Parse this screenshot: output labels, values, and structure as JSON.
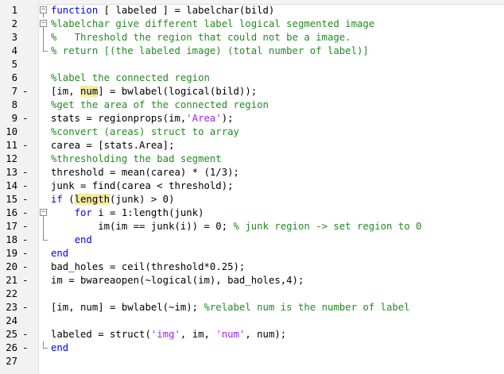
{
  "editor": {
    "lines": [
      {
        "n": "1",
        "dash": false,
        "fold": "box",
        "segments": [
          {
            "t": "function",
            "c": "kw"
          },
          {
            "t": " [ labeled ] = labelchar(bild)",
            "c": ""
          }
        ]
      },
      {
        "n": "2",
        "dash": false,
        "fold": "box",
        "segments": [
          {
            "t": "%labelchar give different label logical segmented image",
            "c": "cm"
          }
        ]
      },
      {
        "n": "3",
        "dash": false,
        "fold": "line",
        "segments": [
          {
            "t": "%   Threshold the region that could not be a image.",
            "c": "cm"
          }
        ]
      },
      {
        "n": "4",
        "dash": false,
        "fold": "end",
        "segments": [
          {
            "t": "% return [(the labeled image) (total number of label)]",
            "c": "cm"
          }
        ]
      },
      {
        "n": "5",
        "dash": false,
        "fold": "",
        "segments": []
      },
      {
        "n": "6",
        "dash": false,
        "fold": "",
        "segments": [
          {
            "t": "%label the connected region",
            "c": "cm"
          }
        ]
      },
      {
        "n": "7",
        "dash": true,
        "fold": "",
        "segments": [
          {
            "t": "[im, ",
            "c": ""
          },
          {
            "t": "num",
            "c": "hl"
          },
          {
            "t": "] = bwlabel(logical(bild));",
            "c": ""
          }
        ]
      },
      {
        "n": "8",
        "dash": false,
        "fold": "",
        "segments": [
          {
            "t": "%get the area of the connected region",
            "c": "cm"
          }
        ]
      },
      {
        "n": "9",
        "dash": true,
        "fold": "",
        "segments": [
          {
            "t": "stats = regionprops(im,",
            "c": ""
          },
          {
            "t": "'Area'",
            "c": "st"
          },
          {
            "t": ");",
            "c": ""
          }
        ]
      },
      {
        "n": "10",
        "dash": false,
        "fold": "",
        "segments": [
          {
            "t": "%convert (areas) struct to array",
            "c": "cm"
          }
        ]
      },
      {
        "n": "11",
        "dash": true,
        "fold": "",
        "segments": [
          {
            "t": "carea = [stats.Area];",
            "c": ""
          }
        ]
      },
      {
        "n": "12",
        "dash": false,
        "fold": "",
        "segments": [
          {
            "t": "%thresholding the bad segment",
            "c": "cm"
          }
        ]
      },
      {
        "n": "13",
        "dash": true,
        "fold": "",
        "segments": [
          {
            "t": "threshold = mean(carea) * (1/3);",
            "c": ""
          }
        ]
      },
      {
        "n": "14",
        "dash": true,
        "fold": "",
        "segments": [
          {
            "t": "junk = find(carea < threshold);",
            "c": ""
          }
        ]
      },
      {
        "n": "15",
        "dash": true,
        "fold": "",
        "segments": [
          {
            "t": "if",
            "c": "kw"
          },
          {
            "t": " (",
            "c": ""
          },
          {
            "t": "length",
            "c": "hl"
          },
          {
            "t": "(junk) > 0)",
            "c": ""
          }
        ]
      },
      {
        "n": "16",
        "dash": true,
        "fold": "box",
        "segments": [
          {
            "t": "    ",
            "c": ""
          },
          {
            "t": "for",
            "c": "kw"
          },
          {
            "t": " i = 1:length(junk)",
            "c": ""
          }
        ]
      },
      {
        "n": "17",
        "dash": true,
        "fold": "line",
        "segments": [
          {
            "t": "        im(im == junk(i)) = 0; ",
            "c": ""
          },
          {
            "t": "% junk region -> set region to 0",
            "c": "cm"
          }
        ]
      },
      {
        "n": "18",
        "dash": true,
        "fold": "end",
        "segments": [
          {
            "t": "    ",
            "c": ""
          },
          {
            "t": "end",
            "c": "kw"
          }
        ]
      },
      {
        "n": "19",
        "dash": true,
        "fold": "",
        "segments": [
          {
            "t": "end",
            "c": "kw"
          }
        ]
      },
      {
        "n": "20",
        "dash": true,
        "fold": "",
        "segments": [
          {
            "t": "bad_holes = ceil(threshold*0.25);",
            "c": ""
          }
        ]
      },
      {
        "n": "21",
        "dash": true,
        "fold": "",
        "segments": [
          {
            "t": "im = bwareaopen(~logical(im), bad_holes,4);",
            "c": ""
          }
        ]
      },
      {
        "n": "22",
        "dash": false,
        "fold": "",
        "segments": []
      },
      {
        "n": "23",
        "dash": true,
        "fold": "",
        "segments": [
          {
            "t": "[im, num] = bwlabel(~im); ",
            "c": ""
          },
          {
            "t": "%relabel num is the number of label",
            "c": "cm"
          }
        ]
      },
      {
        "n": "24",
        "dash": false,
        "fold": "",
        "segments": []
      },
      {
        "n": "25",
        "dash": true,
        "fold": "",
        "segments": [
          {
            "t": "labeled = struct(",
            "c": ""
          },
          {
            "t": "'img'",
            "c": "st"
          },
          {
            "t": ", im, ",
            "c": ""
          },
          {
            "t": "'num'",
            "c": "st"
          },
          {
            "t": ", num);",
            "c": ""
          }
        ]
      },
      {
        "n": "26",
        "dash": true,
        "fold": "end",
        "segments": [
          {
            "t": "end",
            "c": "kw"
          }
        ]
      },
      {
        "n": "27",
        "dash": false,
        "fold": "",
        "segments": []
      }
    ]
  }
}
